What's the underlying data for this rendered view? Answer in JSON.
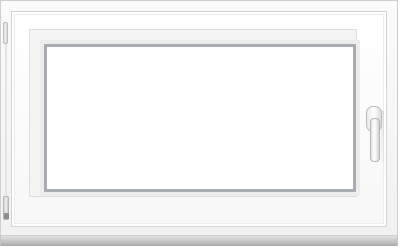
{
  "image": {
    "subject": "window",
    "colors": {
      "frame": "#f4f4f4",
      "glass": "#ffffff",
      "spacer": "#a9adb1",
      "sill": "#bdbdbd",
      "hardware": "#cfcfcf"
    }
  }
}
